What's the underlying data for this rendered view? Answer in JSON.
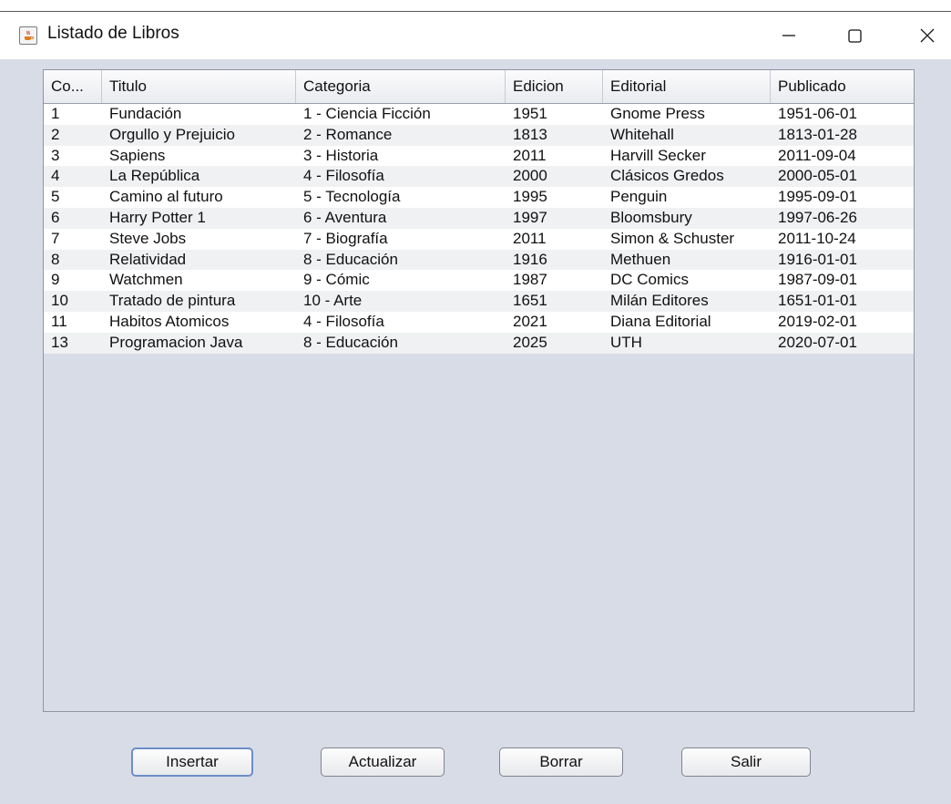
{
  "window": {
    "title": "Listado de Libros",
    "icon": "java-coffee-icon"
  },
  "controls": {
    "minimize_icon": "minimize-icon",
    "maximize_icon": "maximize-icon",
    "close_icon": "close-icon"
  },
  "table": {
    "headers": [
      "Co...",
      "Titulo",
      "Categoria",
      "Edicion",
      "Editorial",
      "Publicado"
    ],
    "rows": [
      [
        "1",
        "Fundación",
        "1 - Ciencia Ficción",
        "1951",
        "Gnome Press",
        "1951-06-01"
      ],
      [
        "2",
        "Orgullo y Prejuicio",
        "2 - Romance",
        "1813",
        "Whitehall",
        "1813-01-28"
      ],
      [
        "3",
        "Sapiens",
        "3 - Historia",
        "2011",
        "Harvill Secker",
        "2011-09-04"
      ],
      [
        "4",
        "La República",
        "4 - Filosofía",
        "2000",
        "Clásicos Gredos",
        "2000-05-01"
      ],
      [
        "5",
        "Camino al futuro",
        "5 - Tecnología",
        "1995",
        "Penguin",
        "1995-09-01"
      ],
      [
        "6",
        "Harry Potter 1",
        "6 - Aventura",
        "1997",
        "Bloomsbury",
        "1997-06-26"
      ],
      [
        "7",
        "Steve Jobs",
        "7 - Biografía",
        "2011",
        "Simon & Schuster",
        "2011-10-24"
      ],
      [
        "8",
        "Relatividad",
        "8 - Educación",
        "1916",
        "Methuen",
        "1916-01-01"
      ],
      [
        "9",
        "Watchmen",
        "9 - Cómic",
        "1987",
        "DC Comics",
        "1987-09-01"
      ],
      [
        "10",
        "Tratado de pintura",
        "10 - Arte",
        "1651",
        "Milán Editores",
        "1651-01-01"
      ],
      [
        "11",
        "Habitos Atomicos",
        "4 - Filosofía",
        "2021",
        "Diana Editorial",
        "2019-02-01"
      ],
      [
        "13",
        "Programacion Java",
        "8 - Educación",
        "2025",
        "UTH",
        "2020-07-01"
      ]
    ]
  },
  "buttons": {
    "insert": "Insertar",
    "update": "Actualizar",
    "delete": "Borrar",
    "exit": "Salir"
  },
  "colors": {
    "background": "#d8dce6",
    "row_alt": "#f0f1f3",
    "focus_border": "#6b8ec9"
  }
}
